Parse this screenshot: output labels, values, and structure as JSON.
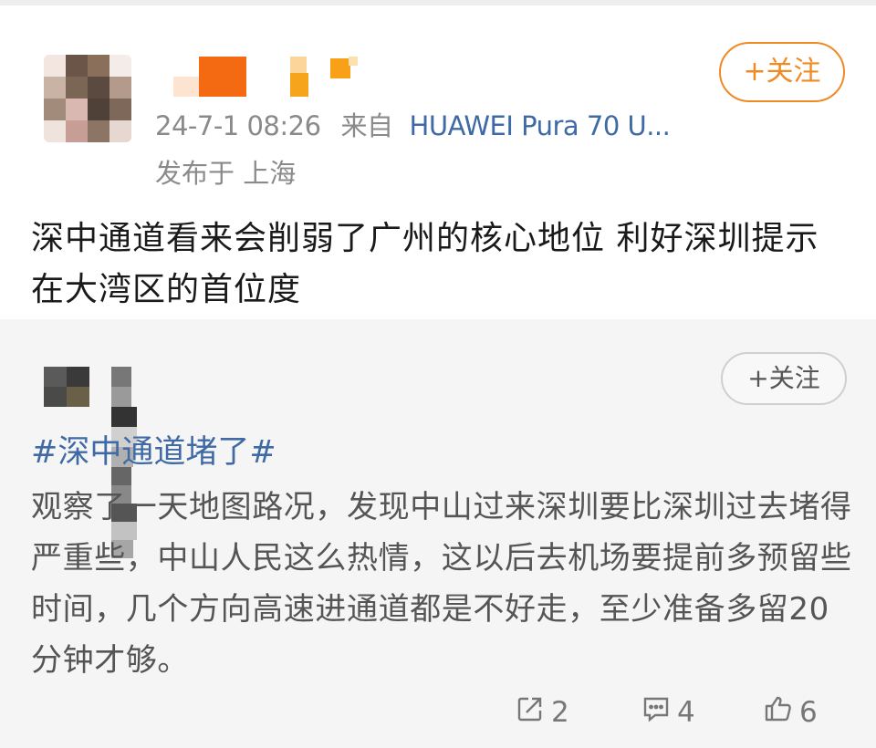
{
  "post": {
    "timestamp": "24-7-1 08:26",
    "source_prefix": "来自",
    "device": "HUAWEI Pura 70 U...",
    "location": "发布于 上海",
    "follow_label": "+关注",
    "text": "深中通道看来会削弱了广州的核心地位 利好深圳提示在大湾区的首位度"
  },
  "quoted": {
    "follow_label": "+关注",
    "topic": "#深中通道堵了#",
    "text": "观察了一天地图路况，发现中山过来深圳要比深圳过去堵得严重些，中山人民这么热情，这以后去机场要提前多预留些时间，几个方向高速进通道都是不好走，至少准备多留20分钟才够。",
    "repost_count": "2",
    "comment_count": "4",
    "like_count": "6"
  },
  "colors": {
    "accent": "#f08a24",
    "link": "#3f6aa6",
    "muted": "#8a8a8a"
  },
  "icons": {
    "repost": "repost-icon",
    "comment": "comment-icon",
    "like": "thumbs-up-icon"
  }
}
